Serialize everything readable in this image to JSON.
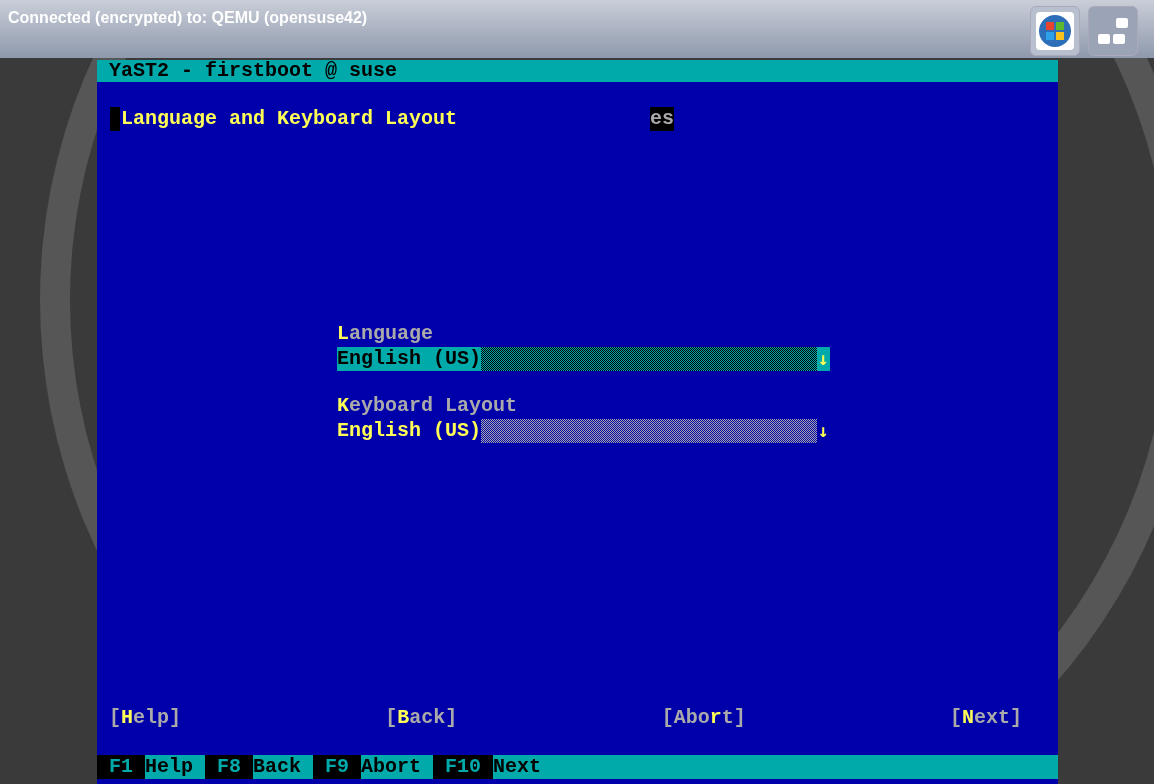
{
  "connection_bar": {
    "title": "Connected (encrypted) to: QEMU (opensuse42)"
  },
  "console": {
    "title": "YaST2 - firstboot @ suse",
    "heading": "Language and Keyboard Layout",
    "corner_text": "es",
    "fields": [
      {
        "label": {
          "hotkey": "L",
          "rest": "anguage"
        },
        "value": "English (US)",
        "arrow": "↓",
        "focused": true
      },
      {
        "label": {
          "hotkey": "K",
          "rest": "eyboard Layout"
        },
        "value": "English (US)",
        "arrow": "↓",
        "focused": false
      }
    ],
    "buttons": [
      {
        "before": "[",
        "hotkey": "H",
        "after": "elp]"
      },
      {
        "before": "[",
        "hotkey": "B",
        "after": "ack]"
      },
      {
        "before": "[Abo",
        "hotkey": "r",
        "after": "t]"
      },
      {
        "before": "[",
        "hotkey": "N",
        "after": "ext]"
      }
    ],
    "function_keys": [
      {
        "key": "F1",
        "label": "Help"
      },
      {
        "key": "F8",
        "label": "Back"
      },
      {
        "key": "F9",
        "label": "Abort"
      },
      {
        "key": "F10",
        "label": "Next"
      }
    ]
  }
}
